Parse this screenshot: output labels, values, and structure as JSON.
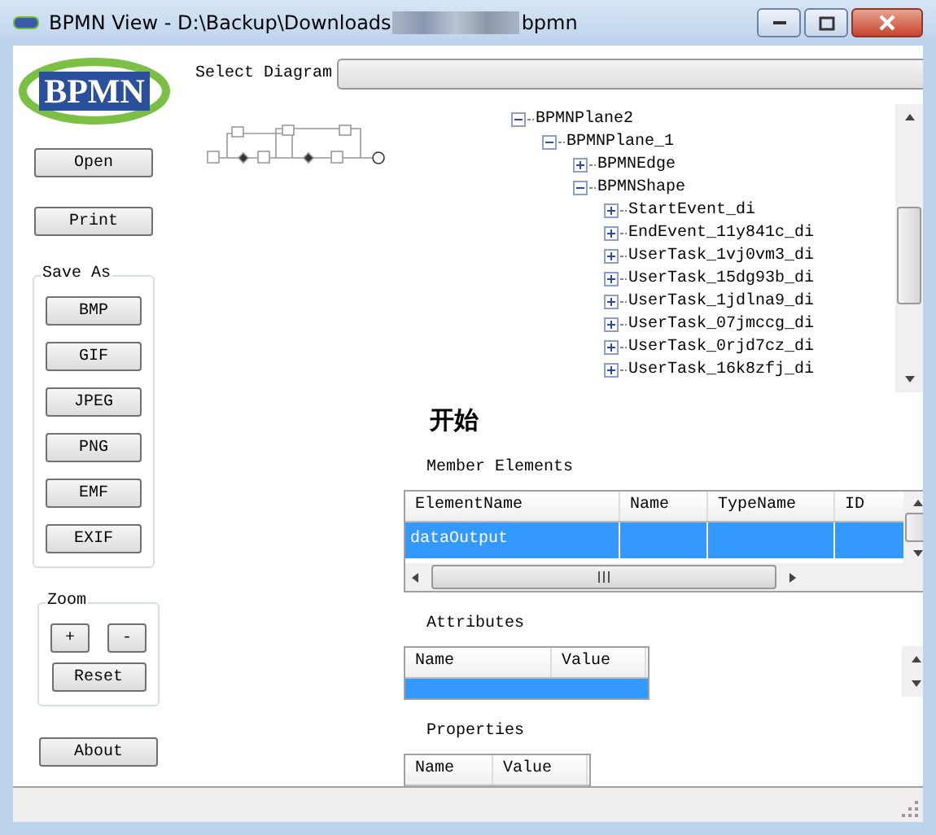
{
  "window": {
    "title_start": "BPMN View - D:\\Backup\\Downloads",
    "title_end": "bpmn"
  },
  "logo": {
    "text": "BPMN"
  },
  "select_diagram": {
    "label": "Select Diagram"
  },
  "buttons": [
    {
      "label": "Open"
    },
    {
      "label": "Print"
    }
  ],
  "save_as": {
    "legend": "Save As",
    "buttons": [
      "BMP",
      "GIF",
      "JPEG",
      "PNG",
      "EMF",
      "EXIF"
    ]
  },
  "zoom": {
    "legend": "Zoom",
    "buttons": [
      "+",
      "-"
    ],
    "reset": "Reset"
  },
  "about": {
    "label": "About"
  },
  "tree": [
    {
      "label": "BPMNPlane2",
      "expanded": true,
      "children": [
        {
          "label": "BPMNPlane_1",
          "expanded": true,
          "children": [
            {
              "label": "BPMNEdge",
              "expanded": false
            },
            {
              "label": "BPMNShape",
              "expanded": true,
              "children": [
                {
                  "label": "StartEvent_di",
                  "expanded": false
                },
                {
                  "label": "EndEvent_11y841c_di",
                  "expanded": false
                },
                {
                  "label": "UserTask_1vj0vm3_di",
                  "expanded": false
                },
                {
                  "label": "UserTask_15dg93b_di",
                  "expanded": false
                },
                {
                  "label": "UserTask_1jdlna9_di",
                  "expanded": false
                },
                {
                  "label": "UserTask_07jmccg_di",
                  "expanded": false
                },
                {
                  "label": "UserTask_0rjd7cz_di",
                  "expanded": false
                },
                {
                  "label": "UserTask_16k8zfj_di",
                  "expanded": false
                }
              ]
            }
          ]
        }
      ]
    }
  ],
  "detail": {
    "heading": "开始",
    "member_elements": {
      "title": "Member Elements",
      "columns": [
        "ElementName",
        "Name",
        "TypeName",
        "ID"
      ],
      "rows": [
        {
          "cells": [
            "dataOutput"
          ],
          "selected": true
        }
      ]
    },
    "attributes": {
      "title": "Attributes",
      "columns": [
        "Name",
        "Value"
      ]
    },
    "properties": {
      "title": "Properties",
      "columns": [
        "Name",
        "Value"
      ]
    }
  }
}
